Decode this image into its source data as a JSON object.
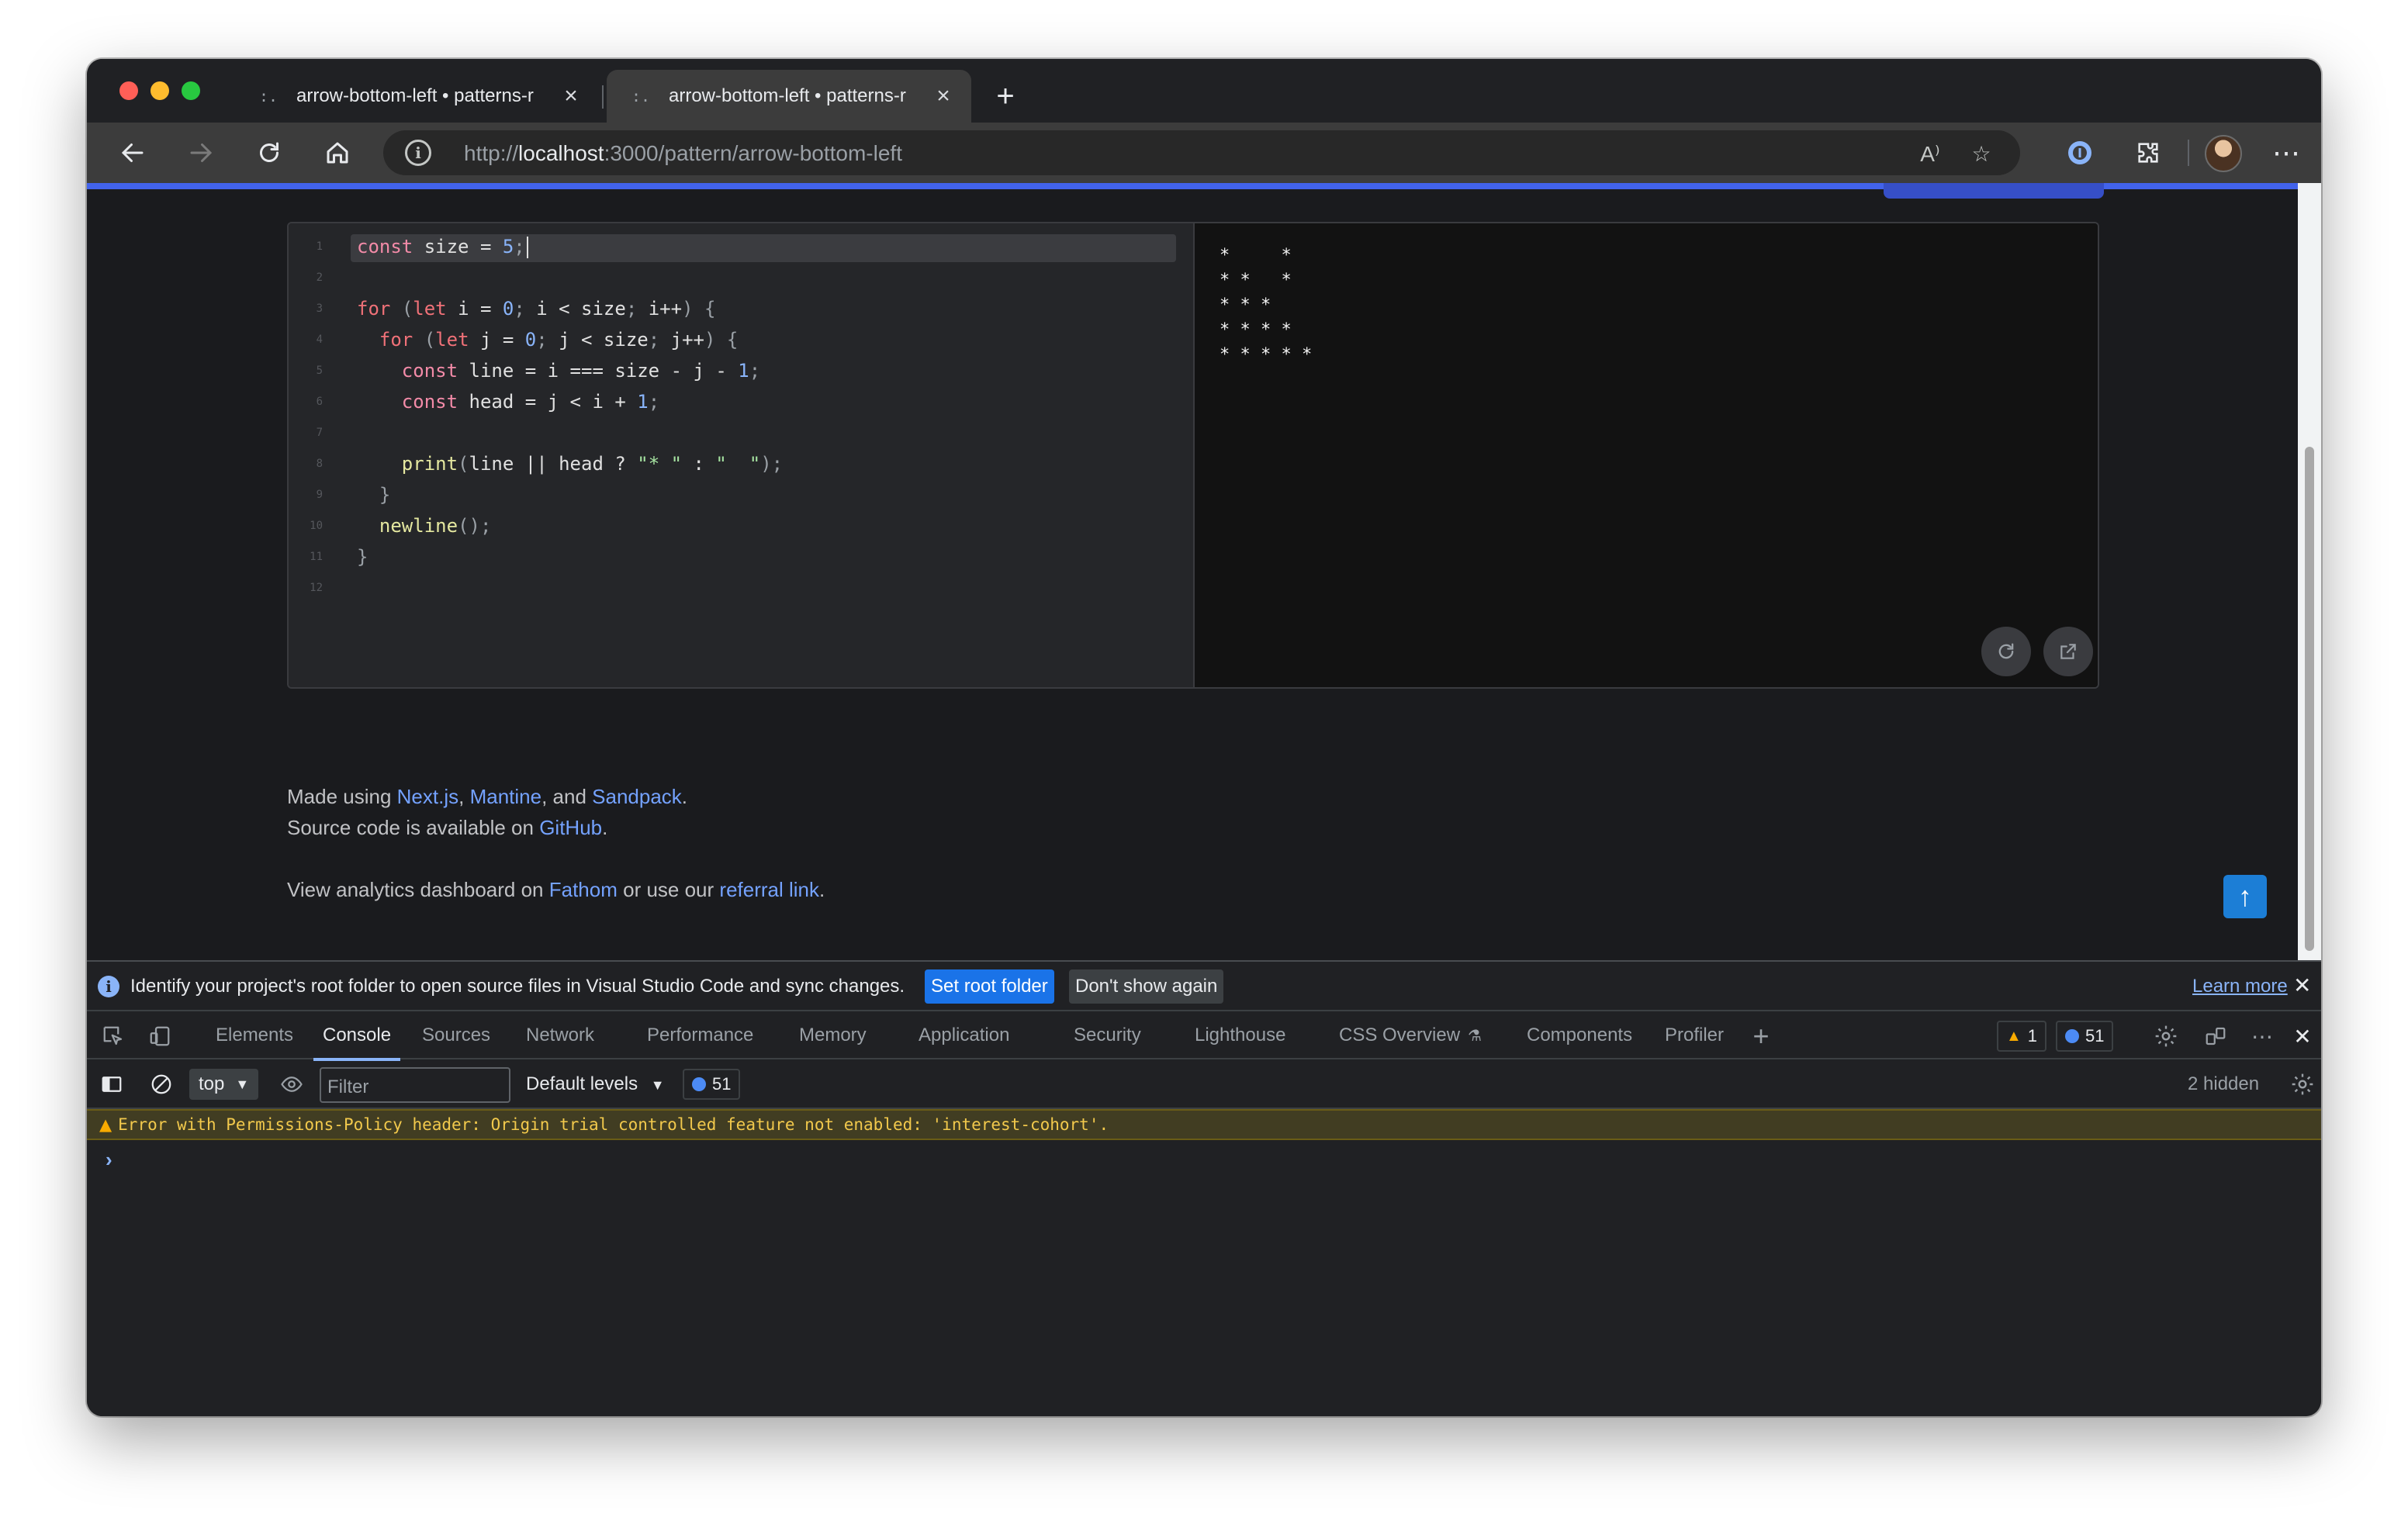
{
  "browser": {
    "tabs": [
      {
        "title": "arrow-bottom-left • patterns-r",
        "favicon": ":."
      },
      {
        "title": "arrow-bottom-left • patterns-r",
        "favicon": ":."
      }
    ],
    "new_tab": "+",
    "url_prefix": "http://",
    "url_host": "localhost",
    "url_rest": ":3000/pattern/arrow-bottom-left"
  },
  "editor": {
    "line_numbers": [
      "1",
      "2",
      "3",
      "4",
      "5",
      "6",
      "7",
      "8",
      "9",
      "10",
      "11",
      "12"
    ]
  },
  "preview": {
    "output_lines": [
      "*     *",
      "* *   *",
      "* * *",
      "* * * *",
      "* * * * *"
    ]
  },
  "footer": {
    "made_using": "Made using ",
    "nextjs": "Next.js",
    "comma": ", ",
    "mantine": "Mantine",
    "and": ", and ",
    "sandpack": "Sandpack",
    "period": ".",
    "source_prefix": "Source code is available on ",
    "github": "GitHub",
    "analytics_prefix": "View analytics dashboard on ",
    "fathom": "Fathom",
    "analytics_mid": " or use our ",
    "referral": "referral link",
    "scroll_top": "↑"
  },
  "devtools": {
    "infobar": {
      "message": "Identify your project's root folder to open source files in Visual Studio Code and sync changes.",
      "set_root": "Set root folder",
      "dont_show": "Don't show again",
      "learn_more": "Learn more"
    },
    "tabs": [
      "Elements",
      "Console",
      "Sources",
      "Network",
      "Performance",
      "Memory",
      "Application",
      "Security",
      "Lighthouse",
      "CSS Overview",
      "Components",
      "Profiler"
    ],
    "warnings_count": "1",
    "messages_count": "51",
    "context": "top",
    "filter_placeholder": "Filter",
    "levels": "Default levels",
    "hidden": "2 hidden",
    "warning_message": "Error with Permissions-Policy header: Origin trial controlled feature not enabled: 'interest-cohort'.",
    "prompt": "›"
  },
  "colors": {
    "accent": "#4263eb",
    "link": "#74a2ff",
    "warning_bg": "#413d22"
  }
}
